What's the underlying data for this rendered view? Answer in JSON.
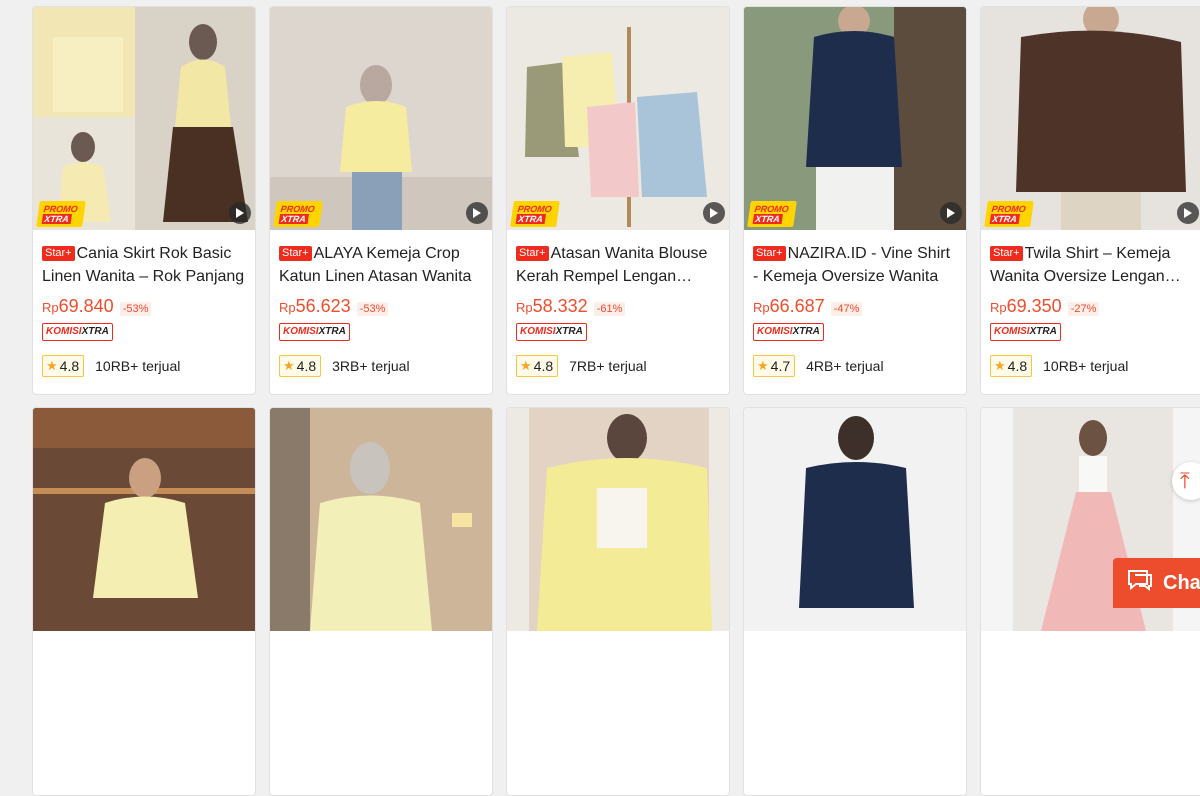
{
  "products": [
    {
      "badge": "Star+",
      "title": "Cania Skirt Rok Basic Linen Wanita – Rok Panjang",
      "currency": "Rp",
      "price": "69.840",
      "discount": "-53%",
      "rating": "4.8",
      "sold": "10RB+ terjual",
      "promo": true,
      "video": true
    },
    {
      "badge": "Star+",
      "title": "ALAYA Kemeja Crop Katun Linen Atasan Wanita",
      "currency": "Rp",
      "price": "56.623",
      "discount": "-53%",
      "rating": "4.8",
      "sold": "3RB+ terjual",
      "promo": true,
      "video": true
    },
    {
      "badge": "Star+",
      "title": "Atasan Wanita Blouse Kerah Rempel Lengan Panjang",
      "currency": "Rp",
      "price": "58.332",
      "discount": "-61%",
      "rating": "4.8",
      "sold": "7RB+ terjual",
      "promo": true,
      "video": true
    },
    {
      "badge": "Star+",
      "title": "NAZIRA.ID - Vine Shirt - Kemeja Oversize Wanita",
      "currency": "Rp",
      "price": "66.687",
      "discount": "-47%",
      "rating": "4.7",
      "sold": "4RB+ terjual",
      "promo": true,
      "video": true
    },
    {
      "badge": "Star+",
      "title": "Twila Shirt – Kemeja Wanita Oversize Lengan Panjang",
      "currency": "Rp",
      "price": "69.350",
      "discount": "-27%",
      "rating": "4.8",
      "sold": "10RB+ terjual",
      "promo": true,
      "video": true
    }
  ],
  "promo_label": {
    "line1": "PROMO",
    "line2": "XTRA"
  },
  "komisi_label": {
    "part1": "KOMISI",
    "part2": "XTRA"
  },
  "chat_label": "Cha",
  "back_top_icon": "arrow-up-icon",
  "colors": {
    "accent": "#ee4d2d",
    "badge_red": "#ee2b1c",
    "promo_yellow": "#ffd400",
    "star": "#f5a623"
  }
}
